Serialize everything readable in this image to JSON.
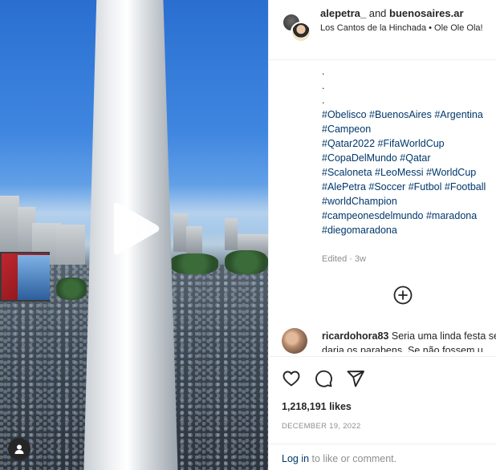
{
  "post": {
    "author1": "alepetra_",
    "and_word": "and",
    "author2": "buenosaires.ar",
    "audio": "Los Cantos de la Hinchada • Ole Ole Ola!"
  },
  "caption": {
    "dots": [
      ".",
      ".",
      "."
    ],
    "tag_lines": [
      "#Obelisco #BuenosAires #Argentina",
      "#Campeon",
      "#Qatar2022 #FifaWorldCup",
      "#CopaDelMundo #Qatar",
      "#Scaloneta #LeoMessi #WorldCup",
      "#AlePetra #Soccer #Futbol #Football",
      "#worldChampion",
      "#campeonesdelmundo #maradona",
      "#diegomaradona"
    ],
    "edited": "Edited · 3w"
  },
  "comment": {
    "username": "ricardohora83",
    "text": "Seria uma linda festa se não fossem os",
    "text_line2": "daria os parabens. Se não fossem u"
  },
  "stats": {
    "likes": "1,218,191 likes",
    "date": "DECEMBER 19, 2022"
  },
  "footer": {
    "login_link": "Log in",
    "login_rest": " to like or comment."
  },
  "icons": {
    "play": "play-icon",
    "user": "user-icon",
    "more": "plus-circle-icon",
    "like": "heart-icon",
    "comment": "comment-icon",
    "share": "send-icon"
  },
  "colors": {
    "text": "#262626",
    "muted": "#8e8e8e",
    "link": "#00376b",
    "border": "#efefef"
  }
}
